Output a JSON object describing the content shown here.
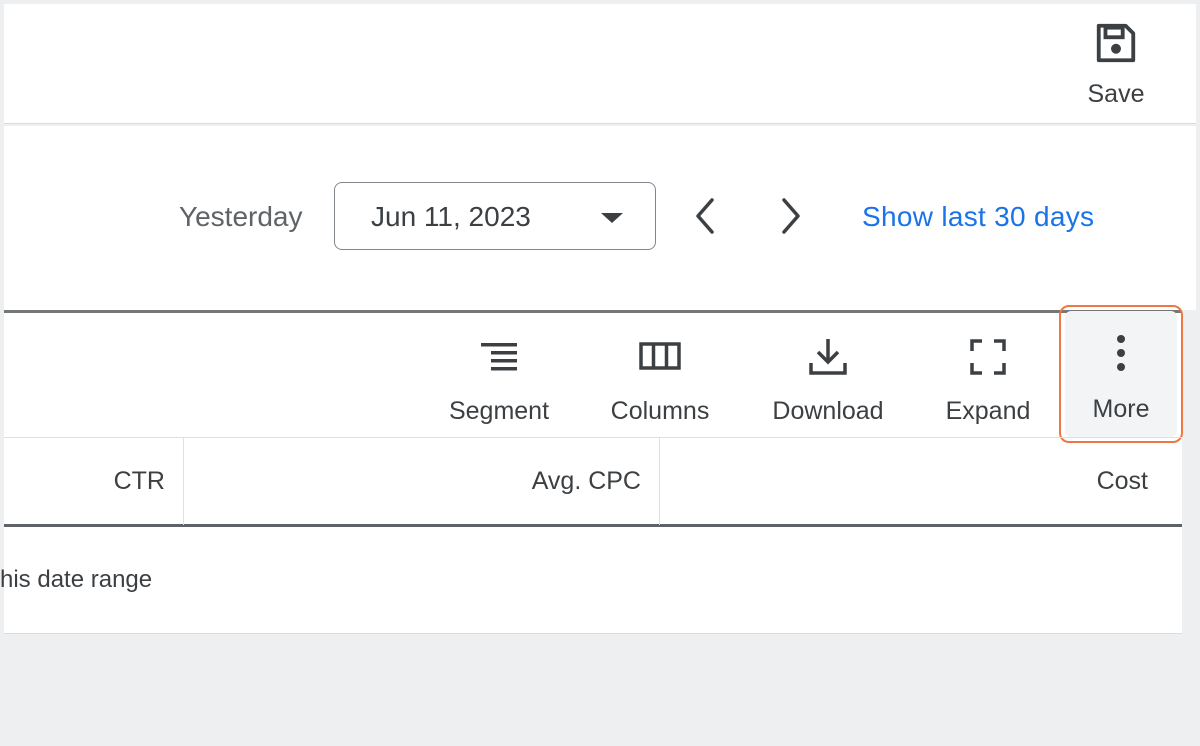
{
  "toolbar_top": {
    "save_label": "Save",
    "save_icon": "save-icon"
  },
  "date_bar": {
    "preset_label": "Yesterday",
    "selected_date": "Jun 11, 2023",
    "prev_icon": "chevron-left-icon",
    "next_icon": "chevron-right-icon",
    "show_last_label": "Show last 30 days"
  },
  "table_toolbar": {
    "segment_label": "Segment",
    "columns_label": "Columns",
    "download_label": "Download",
    "expand_label": "Expand",
    "more_label": "More"
  },
  "table": {
    "headers": [
      "CTR",
      "Avg. CPC",
      "Cost"
    ],
    "empty_message": "his date range"
  },
  "colors": {
    "link": "#1a73e8",
    "highlight": "#ee7744",
    "text": "#3c4043"
  }
}
